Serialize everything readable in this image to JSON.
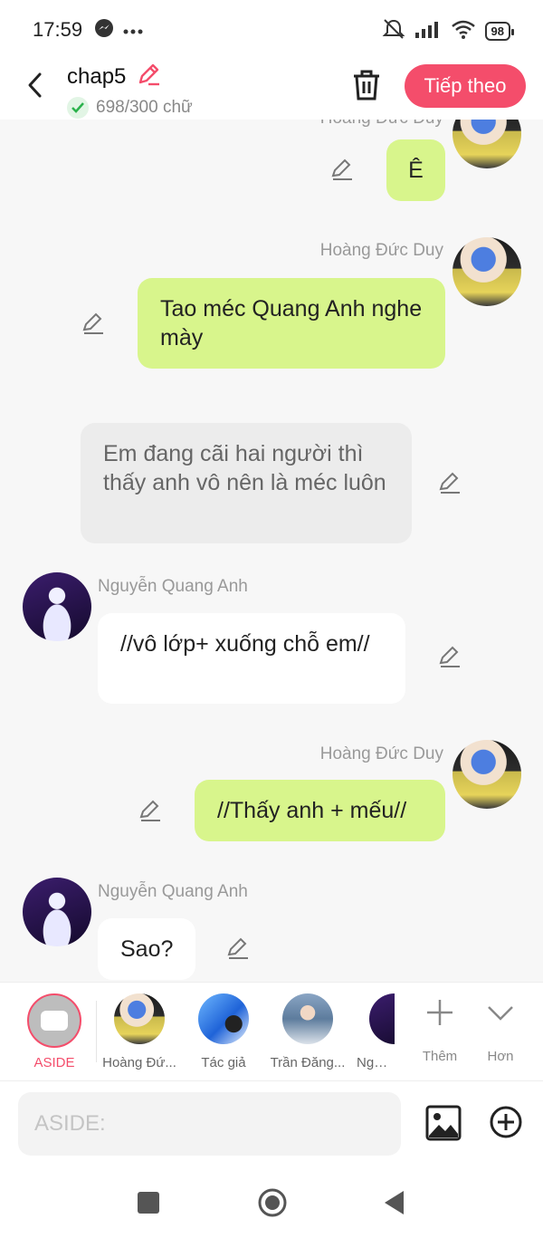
{
  "status": {
    "time": "17:59",
    "battery": "98"
  },
  "header": {
    "title": "chap5",
    "word_count": "698/300 chữ",
    "next_label": "Tiếp theo"
  },
  "messages": [
    {
      "speaker": "Hoàng Đức Duy",
      "text": "Ê"
    },
    {
      "speaker": "Hoàng Đức Duy",
      "text": "Tao méc Quang Anh nghe mày"
    },
    {
      "speaker": "",
      "text": "Em đang cãi hai người thì thấy anh vô nên là méc luôn"
    },
    {
      "speaker": "Nguyễn Quang Anh",
      "text": "//vô lớp+ xuống chỗ em//"
    },
    {
      "speaker": "Hoàng Đức Duy",
      "text": "//Thấy anh + mếu//"
    },
    {
      "speaker": "Nguyễn Quang Anh",
      "text": "Sao?"
    }
  ],
  "characters": {
    "aside_label": "ASIDE",
    "items": [
      "Hoàng Đứ...",
      "Tác giả",
      "Trần Đăng...",
      "Nguyễ"
    ],
    "add_label": "Thêm",
    "more_label": "Hơn"
  },
  "input": {
    "placeholder": "ASIDE:"
  },
  "colors": {
    "accent": "#f44d6b",
    "bubble_green": "#d8f58c",
    "bubble_gray": "#ececec"
  }
}
